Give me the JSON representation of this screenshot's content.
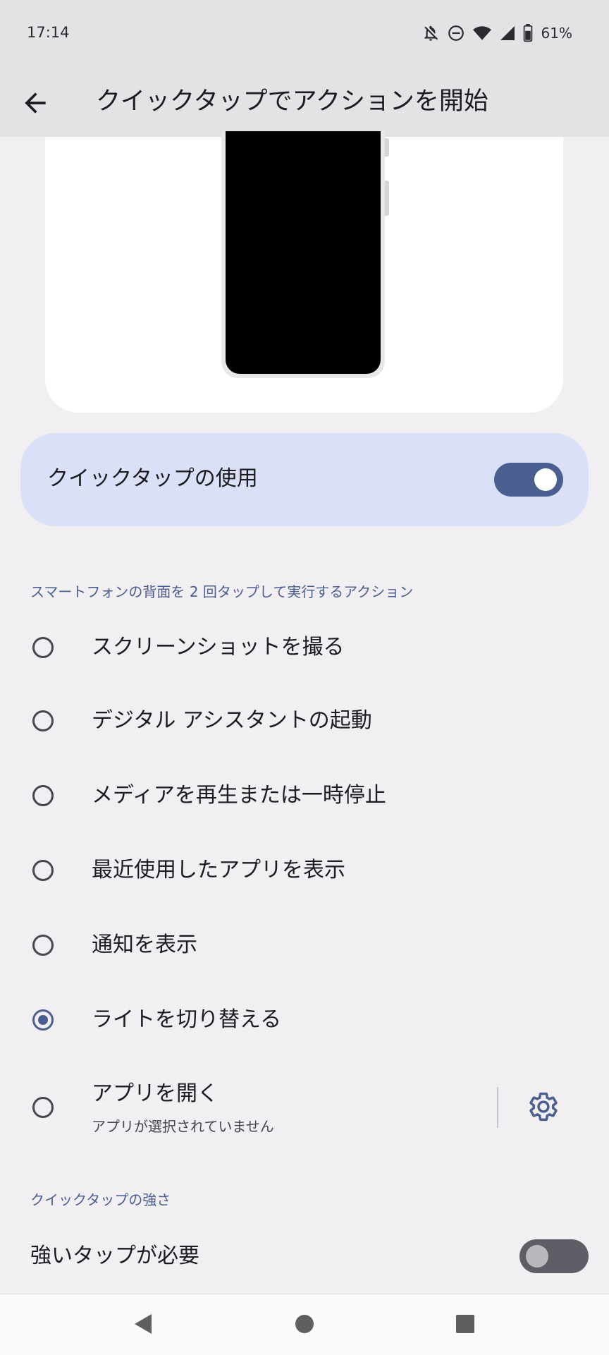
{
  "status_bar": {
    "time": "17:14",
    "battery": "61%",
    "icons": [
      "notifications-off-icon",
      "do-not-disturb-icon",
      "wifi-icon",
      "cell-signal-icon",
      "battery-icon"
    ]
  },
  "app_bar": {
    "title": "クイックタップでアクションを開始",
    "back_icon": "arrow-back-icon"
  },
  "main_switch": {
    "label": "クイックタップの使用",
    "enabled": true
  },
  "actions_section": {
    "header": "スマートフォンの背面を 2 回タップして実行するアクション",
    "options": [
      {
        "label": "スクリーンショットを撮る",
        "selected": false
      },
      {
        "label": "デジタル アシスタントの起動",
        "selected": false
      },
      {
        "label": "メディアを再生または一時停止",
        "selected": false
      },
      {
        "label": "最近使用したアプリを表示",
        "selected": false
      },
      {
        "label": "通知を表示",
        "selected": false
      },
      {
        "label": "ライトを切り替える",
        "selected": true
      },
      {
        "label": "アプリを開く",
        "sublabel": "アプリが選択されていません",
        "selected": false,
        "settings_icon": "gear-icon"
      }
    ]
  },
  "strength_section": {
    "header": "クイックタップの強さ",
    "strong_tap_label": "強いタップが必要",
    "strong_tap_enabled": false
  },
  "nav_bar": {
    "buttons": [
      "back-triangle-icon",
      "home-circle-icon",
      "recents-square-icon"
    ]
  },
  "colors": {
    "accent": "#4a5f90",
    "switch_container": "#d9e0f8",
    "background": "#f2eff3",
    "app_bar": "#e5e2e6"
  }
}
